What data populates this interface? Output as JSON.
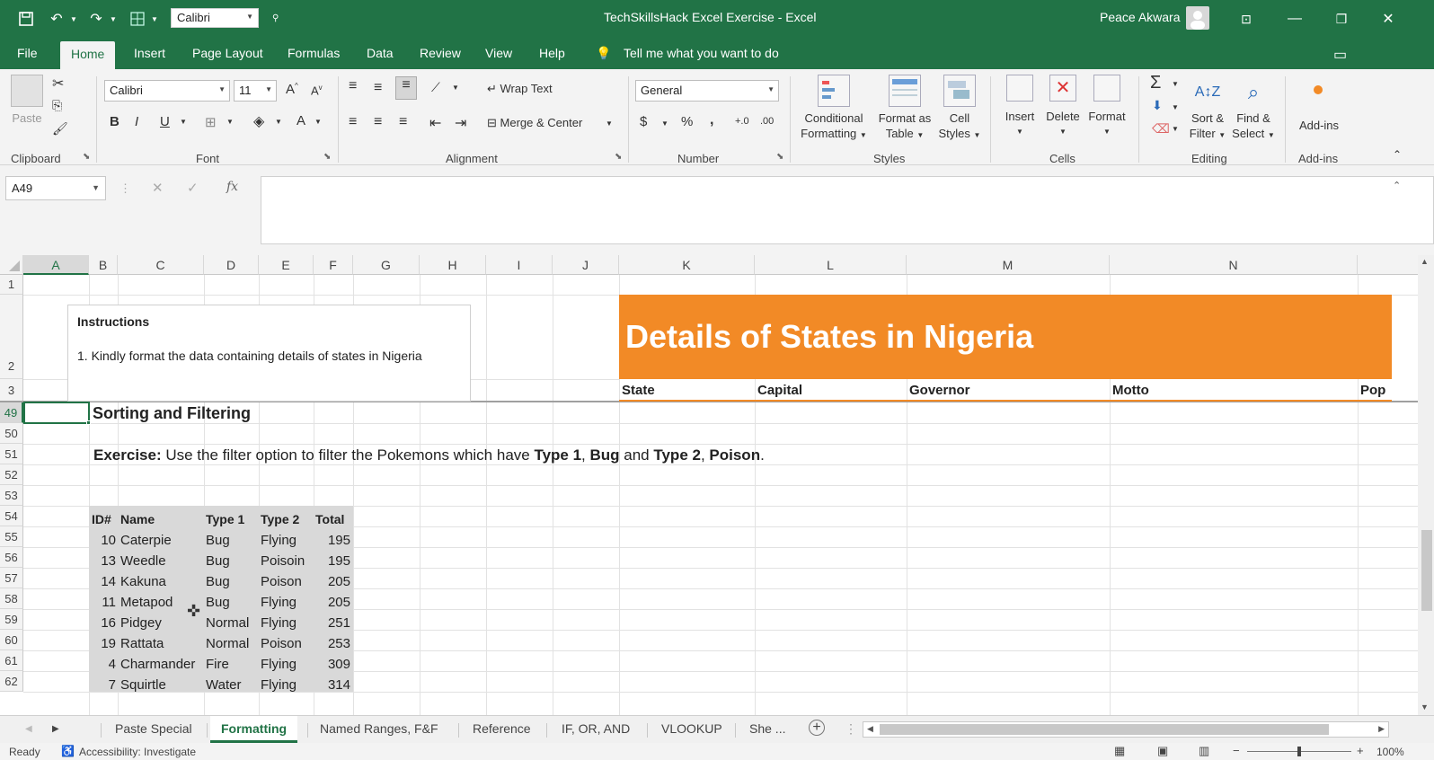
{
  "window": {
    "title": "TechSkillsHack Excel Exercise  -  Excel",
    "user": "Peace Akwara",
    "qat_font": "Calibri"
  },
  "ribbon_tabs": [
    "File",
    "Home",
    "Insert",
    "Page Layout",
    "Formulas",
    "Data",
    "Review",
    "View",
    "Help"
  ],
  "tell_me": "Tell me what you want to do",
  "ribbon": {
    "clipboard": {
      "paste": "Paste",
      "label": "Clipboard"
    },
    "font": {
      "name": "Calibri",
      "size": "11",
      "label": "Font",
      "bold": "B",
      "italic": "I",
      "underline": "U"
    },
    "alignment": {
      "wrap": "Wrap Text",
      "merge": "Merge & Center",
      "label": "Alignment"
    },
    "number": {
      "format": "General",
      "label": "Number",
      "percent": "%",
      "comma": ","
    },
    "styles": {
      "cond1": "Conditional",
      "cond2": "Formatting",
      "fat1": "Format as",
      "fat2": "Table",
      "cs1": "Cell",
      "cs2": "Styles",
      "label": "Styles"
    },
    "cells": {
      "insert": "Insert",
      "delete": "Delete",
      "format": "Format",
      "label": "Cells"
    },
    "editing": {
      "sort1": "Sort &",
      "sort2": "Filter",
      "find1": "Find &",
      "find2": "Select",
      "label": "Editing"
    },
    "addins": {
      "btn": "Add-ins",
      "label": "Add-ins"
    }
  },
  "formula_bar": {
    "name_box": "A49",
    "fx": "fx",
    "value": ""
  },
  "columns": [
    "A",
    "B",
    "C",
    "D",
    "E",
    "F",
    "G",
    "H",
    "I",
    "J",
    "K",
    "L",
    "M",
    "N"
  ],
  "rows": [
    "1",
    "2",
    "3",
    "49",
    "50",
    "51",
    "52",
    "53",
    "54",
    "55",
    "56",
    "57",
    "58",
    "59",
    "60",
    "61",
    "62"
  ],
  "instructions": {
    "title": "Instructions",
    "body": "1. Kindly format the data containing details of states in Nigeria"
  },
  "banner": "Details of States in Nigeria",
  "states_headers": [
    "State",
    "Capital",
    "Governor",
    "Motto",
    "Pop"
  ],
  "section_title": "Sorting and Filtering",
  "exercise": {
    "label": "Exercise:",
    "t1": " Use the filter option to filter the Pokemons which have ",
    "b1": "Type 1",
    "t2": ", ",
    "b2": "Bug",
    "t3": " and ",
    "b3": "Type 2",
    "t4": ", ",
    "b4": "Poison",
    "t5": "."
  },
  "table": {
    "headers": [
      "ID#",
      "Name",
      "Type 1",
      "Type 2",
      "Total"
    ],
    "rows": [
      [
        "10",
        "Caterpie",
        "Bug",
        "Flying",
        "195"
      ],
      [
        "13",
        "Weedle",
        "Bug",
        "Poisoin",
        "195"
      ],
      [
        "14",
        "Kakuna",
        "Bug",
        "Poison",
        "205"
      ],
      [
        "11",
        "Metapod",
        "Bug",
        "Flying",
        "205"
      ],
      [
        "16",
        "Pidgey",
        "Normal",
        "Flying",
        "251"
      ],
      [
        "19",
        "Rattata",
        "Normal",
        "Poison",
        "253"
      ],
      [
        "4",
        "Charmander",
        "Fire",
        "Flying",
        "309"
      ],
      [
        "7",
        "Squirtle",
        "Water",
        "Flying",
        "314"
      ]
    ]
  },
  "sheet_tabs": [
    "Paste Special",
    "Formatting",
    "Named Ranges, F&F",
    "Reference",
    "IF, OR, AND",
    "VLOOKUP",
    "She ..."
  ],
  "active_sheet": "Formatting",
  "status": {
    "ready": "Ready",
    "accessibility": "Accessibility: Investigate",
    "zoom": "100%"
  },
  "colors": {
    "excel_green": "#217346",
    "banner_orange": "#f28a26"
  }
}
